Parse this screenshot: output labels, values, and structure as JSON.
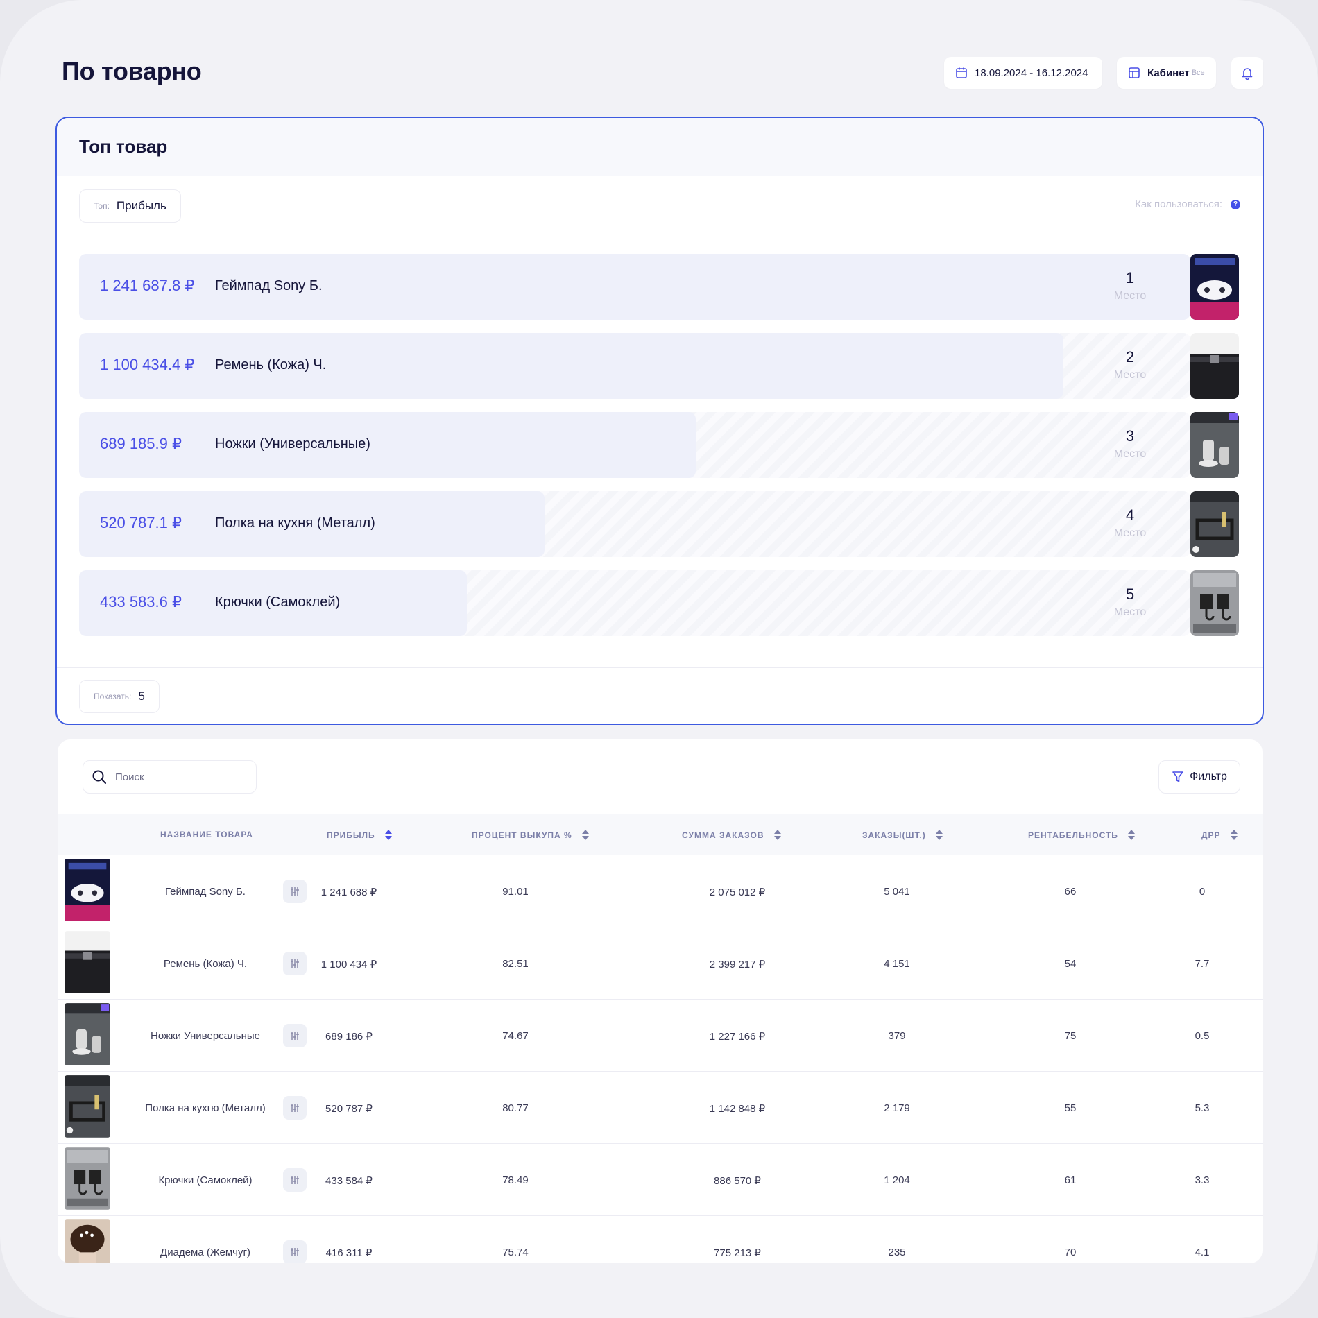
{
  "page": {
    "title": "По товарно"
  },
  "header": {
    "date_range": "18.09.2024 - 16.12.2024",
    "cabinet_label": "Кабинет",
    "cabinet_value": "Все"
  },
  "top_card": {
    "title": "Топ товар",
    "top_label": "Топ:",
    "top_value": "Прибыль",
    "howto_label": "Как пользоваться:",
    "help_glyph": "?",
    "show_label": "Показать:",
    "show_value": "5",
    "place_caption": "Место",
    "items": [
      {
        "value": "1 241 687.8 ₽",
        "name": "Геймпад Sony Б.",
        "place": "1",
        "share": 1.0
      },
      {
        "value": "1 100 434.4 ₽",
        "name": "Ремень (Кожа) Ч.",
        "place": "2",
        "share": 0.886
      },
      {
        "value": "689 185.9 ₽",
        "name": "Ножки (Универсальные)",
        "place": "3",
        "share": 0.555
      },
      {
        "value": "520 787.1 ₽",
        "name": "Полка на кухня (Металл)",
        "place": "4",
        "share": 0.419
      },
      {
        "value": "433 583.6 ₽",
        "name": "Крючки (Самоклей)",
        "place": "5",
        "share": 0.349
      }
    ]
  },
  "table": {
    "search_placeholder": "Поиск",
    "filter_label": "Фильтр",
    "columns": {
      "name": "Название товара",
      "profit": "Прибыль",
      "pct": "Процент выкупа %",
      "sum": "Сумма заказов",
      "orders": "Заказы(шт.)",
      "rent": "Рентабельность",
      "drr": "ДРР"
    },
    "rows": [
      {
        "name": "Геймпад Sony Б.",
        "profit": "1 241 688 ₽",
        "pct": "91.01",
        "sum": "2 075 012 ₽",
        "orders": "5 041",
        "rent": "66",
        "drr": "0"
      },
      {
        "name": "Ремень (Кожа) Ч.",
        "profit": "1 100 434 ₽",
        "pct": "82.51",
        "sum": "2 399 217 ₽",
        "orders": "4 151",
        "rent": "54",
        "drr": "7.7"
      },
      {
        "name": "Ножки Универсальные",
        "profit": "689 186 ₽",
        "pct": "74.67",
        "sum": "1 227 166 ₽",
        "orders": "379",
        "rent": "75",
        "drr": "0.5"
      },
      {
        "name": "Полка на кухгю (Металл)",
        "profit": "520 787 ₽",
        "pct": "80.77",
        "sum": "1 142 848 ₽",
        "orders": "2 179",
        "rent": "55",
        "drr": "5.3"
      },
      {
        "name": "Крючки (Самоклей)",
        "profit": "433 584 ₽",
        "pct": "78.49",
        "sum": "886 570 ₽",
        "orders": "1 204",
        "rent": "61",
        "drr": "3.3"
      },
      {
        "name": "Диадема (Жемчуг)",
        "profit": "416 311 ₽",
        "pct": "75.74",
        "sum": "775 213 ₽",
        "orders": "235",
        "rent": "70",
        "drr": "4.1"
      }
    ]
  },
  "colors": {
    "accent": "#4a4fe6",
    "border_active": "#3d5ae0",
    "background": "#f2f2f6"
  }
}
